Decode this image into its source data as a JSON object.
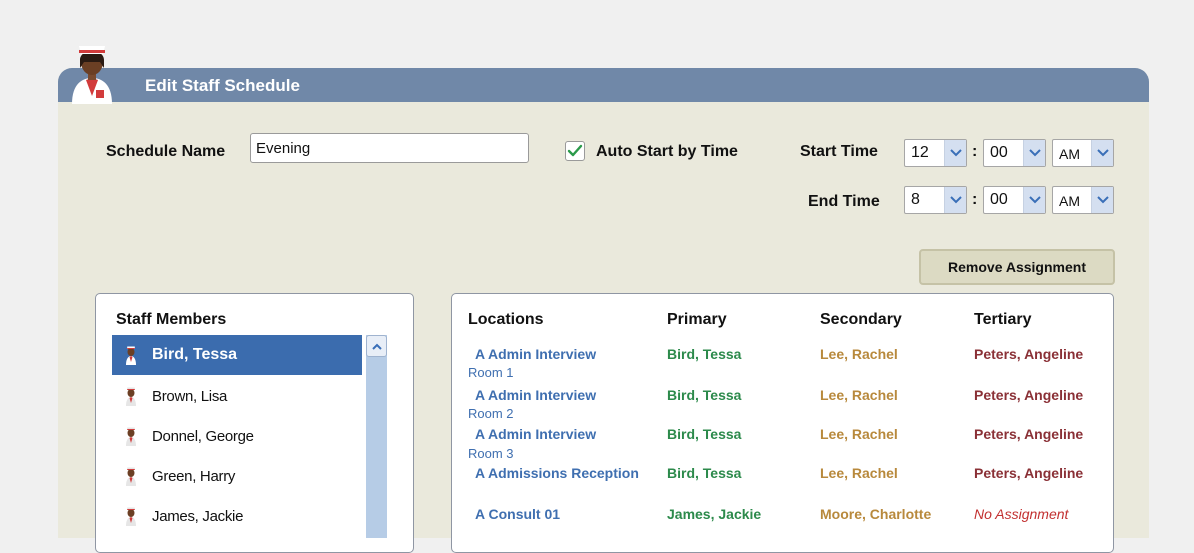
{
  "window": {
    "title": "Edit Staff Schedule"
  },
  "form": {
    "schedule_name_label": "Schedule Name",
    "schedule_name_value": "Evening",
    "auto_start_label": "Auto Start by Time",
    "auto_start_checked": true,
    "start_time_label": "Start Time",
    "end_time_label": "End Time",
    "start_time": {
      "hour": "12",
      "minute": "00",
      "ampm": "AM"
    },
    "end_time": {
      "hour": "8",
      "minute": "00",
      "ampm": "AM"
    },
    "colon": ":"
  },
  "actions": {
    "remove_assignment": "Remove Assignment"
  },
  "staff": {
    "heading": "Staff Members",
    "members": [
      "Bird, Tessa",
      "Brown, Lisa",
      "Donnel, George",
      "Green, Harry",
      "James, Jackie"
    ],
    "selected_index": 0
  },
  "assignments": {
    "columns": [
      "Locations",
      "Primary",
      "Secondary",
      "Tertiary"
    ],
    "rows": [
      {
        "location": "A Admin Interview",
        "location_sub": "Room 1",
        "primary": "Bird, Tessa",
        "secondary": "Lee, Rachel",
        "tertiary": "Peters, Angeline"
      },
      {
        "location": "A Admin Interview",
        "location_sub": "Room 2",
        "primary": "Bird, Tessa",
        "secondary": "Lee, Rachel",
        "tertiary": "Peters, Angeline"
      },
      {
        "location": "A Admin Interview",
        "location_sub": "Room 3",
        "primary": "Bird, Tessa",
        "secondary": "Lee, Rachel",
        "tertiary": "Peters, Angeline"
      },
      {
        "location": "A Admissions Reception",
        "primary": "Bird, Tessa",
        "secondary": "Lee, Rachel",
        "tertiary": "Peters, Angeline"
      },
      {
        "location": "A Consult 01",
        "primary": "James, Jackie",
        "secondary": "Moore, Charlotte",
        "tertiary": "No Assignment"
      }
    ]
  },
  "colors": {
    "header": "#7088a8",
    "panel": "#eae9dc",
    "selection": "#3b6cae",
    "location": "#3f6fb0",
    "primary": "#2c8a4b",
    "secondary": "#b8893c",
    "tertiary": "#8a3036",
    "no_assignment": "#c23030"
  },
  "icons": {
    "avatar": "nurse-avatar-icon",
    "staff": "staff-person-icon",
    "dropdown": "chevron-down-icon",
    "check": "checkmark-icon",
    "scroll": "chevron-up-icon"
  }
}
